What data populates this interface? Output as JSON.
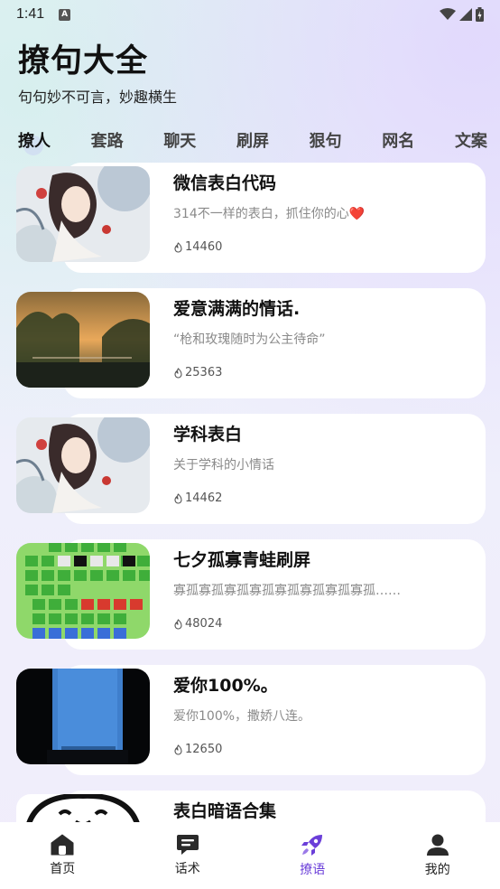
{
  "status": {
    "time": "1:41",
    "notif_icon": "A"
  },
  "header": {
    "title": "撩句大全",
    "subtitle": "句句妙不可言，妙趣横生"
  },
  "tabs": [
    {
      "label": "撩人",
      "active": true
    },
    {
      "label": "套路"
    },
    {
      "label": "聊天"
    },
    {
      "label": "刷屏"
    },
    {
      "label": "狠句"
    },
    {
      "label": "网名"
    },
    {
      "label": "文案"
    }
  ],
  "items": [
    {
      "title": "微信表白代码",
      "desc": "314不一样的表白，抓住你的心",
      "heart": "❤️",
      "hot": "14460",
      "thumb": "anime-girl-illustration"
    },
    {
      "title": "爱意满满的情话.",
      "desc": "“枪和玫瑰随时为公主待命”",
      "hot": "25363",
      "thumb": "sunset-trees-photo"
    },
    {
      "title": "学科表白",
      "desc": "关于学科的小情话",
      "hot": "14462",
      "thumb": "anime-girl-illustration"
    },
    {
      "title": "七夕孤寡青蛙刷屏",
      "desc": "寡孤寡孤寡孤寡孤寡孤寡孤寡孤寡孤……",
      "hot": "48024",
      "thumb": "pixel-frog"
    },
    {
      "title": "爱你100%。",
      "desc": "爱你100%，撒娇八连。",
      "hot": "12650",
      "thumb": "blue-window-photo"
    },
    {
      "title": "表白暗语合集",
      "desc": "",
      "hot": "",
      "thumb": "meme-face"
    }
  ],
  "nav": [
    {
      "label": "首页",
      "icon": "home-icon"
    },
    {
      "label": "话术",
      "icon": "chat-icon"
    },
    {
      "label": "撩语",
      "icon": "rocket-icon",
      "active": true
    },
    {
      "label": "我的",
      "icon": "profile-icon"
    }
  ],
  "colors": {
    "accent": "#6b3fd9",
    "heart": "#d8262d",
    "card": "#ffffff"
  }
}
